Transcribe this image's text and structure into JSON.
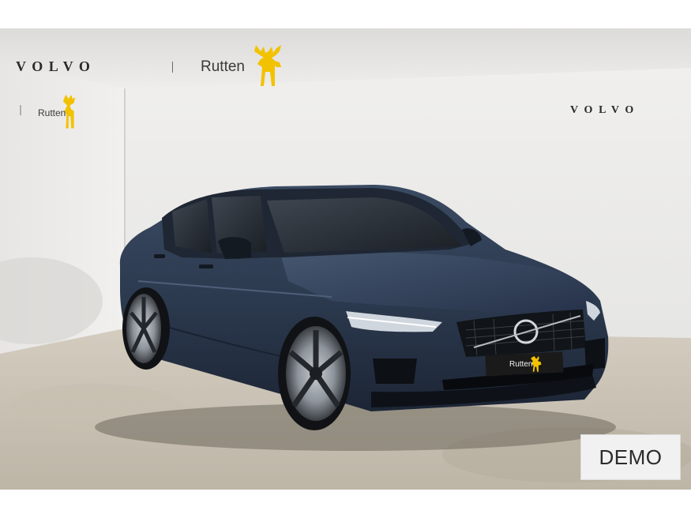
{
  "banner": {
    "brand": "VOLVO",
    "dealer": "Rutten",
    "dealer_logo_icon": "moose-icon"
  },
  "wall_left": {
    "dealer": "Rutten",
    "dealer_logo_icon": "moose-icon"
  },
  "wall_right": {
    "brand": "VOLVO"
  },
  "car": {
    "plate": "Rutten",
    "plate_logo_icon": "moose-icon",
    "color": "#2c3a4f"
  },
  "badge": {
    "label": "DEMO"
  },
  "colors": {
    "dealer_yellow": "#f2c200"
  }
}
